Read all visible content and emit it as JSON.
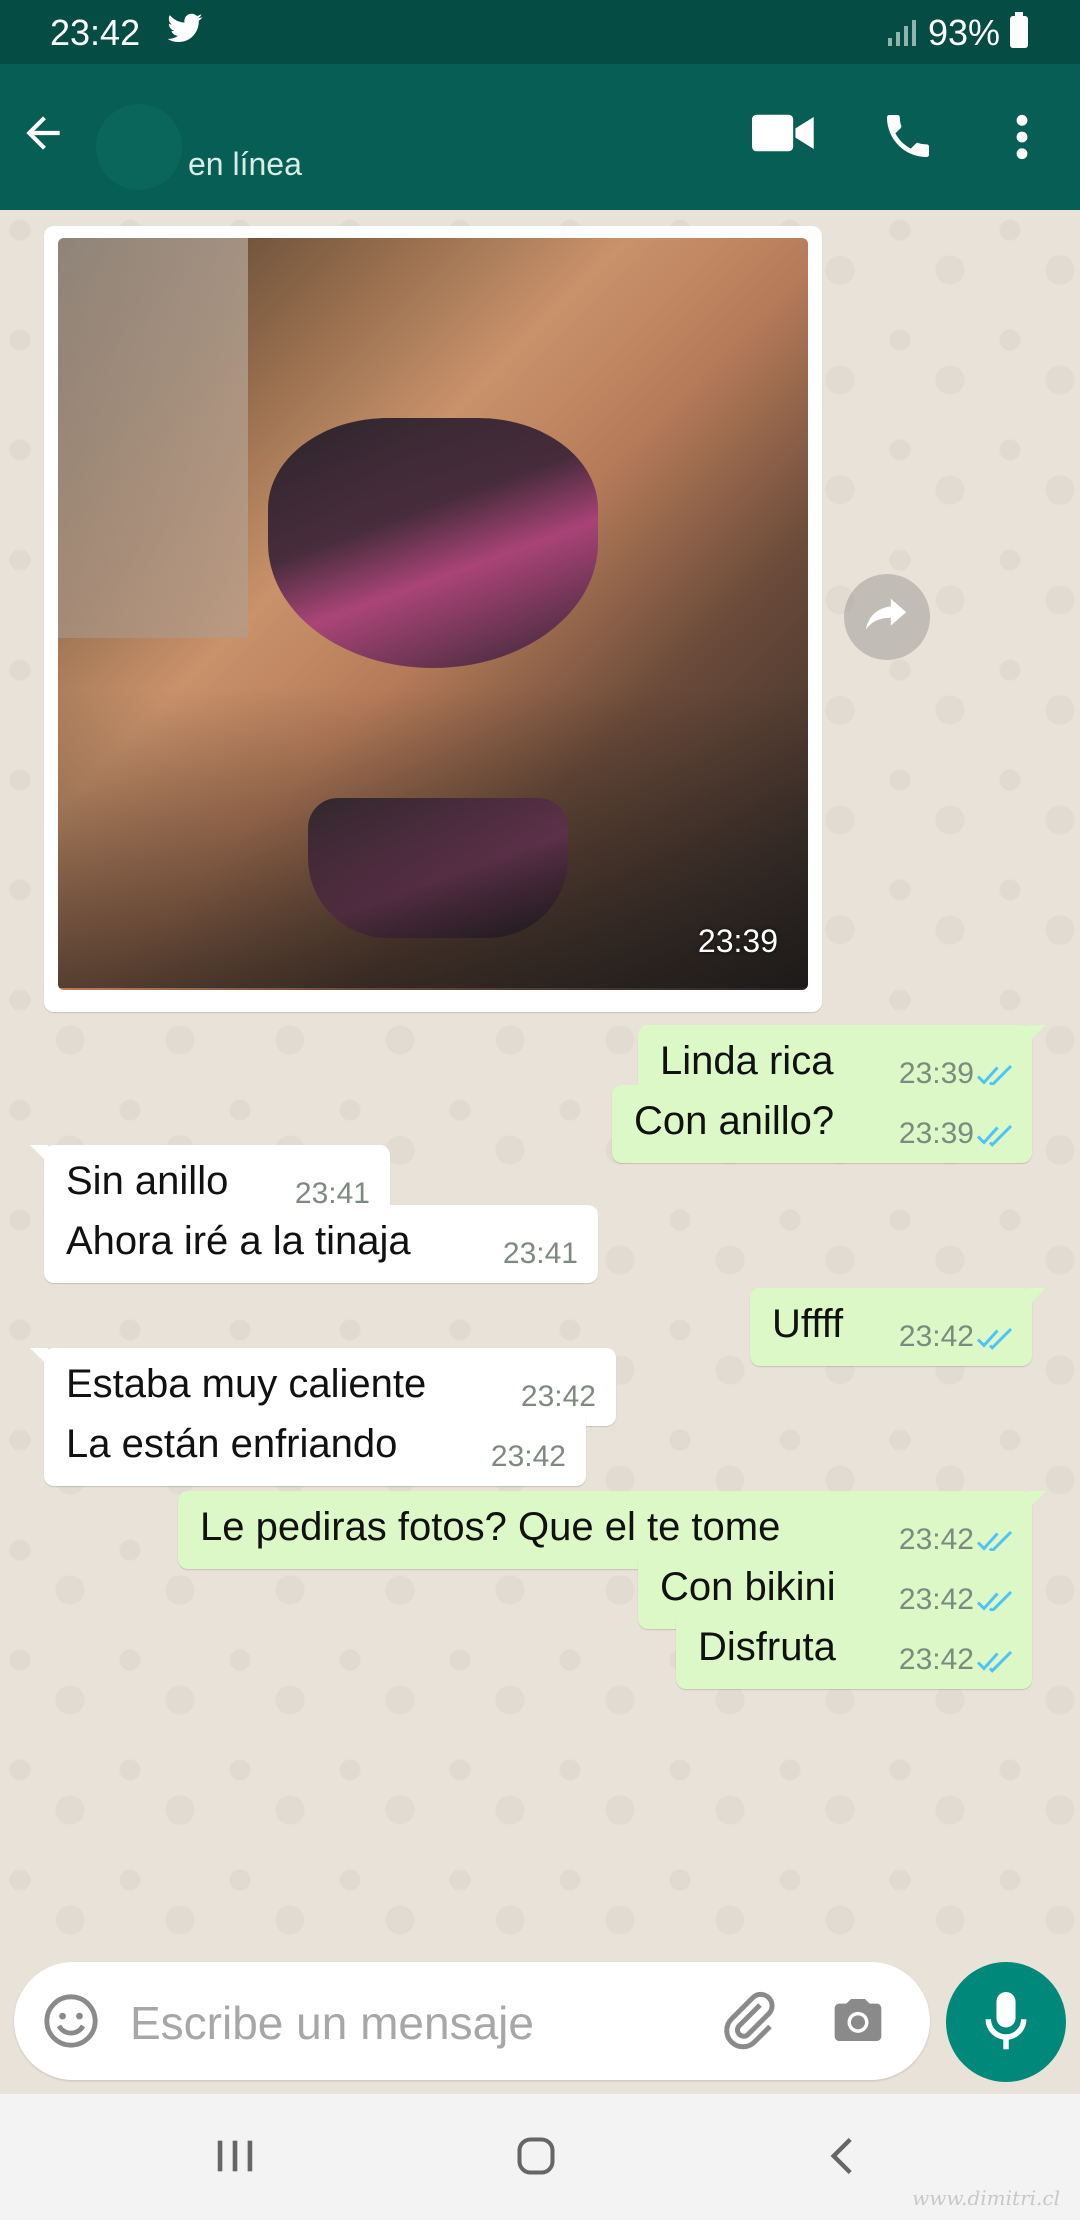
{
  "status_bar": {
    "time": "23:42",
    "battery": "93%"
  },
  "header": {
    "status": "en línea"
  },
  "photo_message": {
    "time": "23:39"
  },
  "messages": [
    {
      "dir": "out",
      "text": "Linda rica",
      "time": "23:39",
      "read": true
    },
    {
      "dir": "out",
      "text": "Con anillo?",
      "time": "23:39",
      "read": true
    },
    {
      "dir": "in",
      "text": "Sin anillo",
      "time": "23:41"
    },
    {
      "dir": "in",
      "text": "Ahora iré a la tinaja",
      "time": "23:41"
    },
    {
      "dir": "out",
      "text": "Uffff",
      "time": "23:42",
      "read": true
    },
    {
      "dir": "in",
      "text": "Estaba muy caliente",
      "time": "23:42"
    },
    {
      "dir": "in",
      "text": "La están enfriando",
      "time": "23:42"
    },
    {
      "dir": "out",
      "text": "Le pediras fotos? Que el te tome",
      "time": "23:42",
      "read": true
    },
    {
      "dir": "out",
      "text": "Con bikini",
      "time": "23:42",
      "read": true
    },
    {
      "dir": "out",
      "text": "Disfruta",
      "time": "23:42",
      "read": true
    }
  ],
  "input": {
    "placeholder": "Escribe un mensaje"
  },
  "watermark": "www.dimitri.cl",
  "colors": {
    "header": "#075e54",
    "outgoing_bubble": "#dcf8c6",
    "incoming_bubble": "#ffffff",
    "read_ticks": "#4fc3f7",
    "mic_button": "#00897b"
  }
}
